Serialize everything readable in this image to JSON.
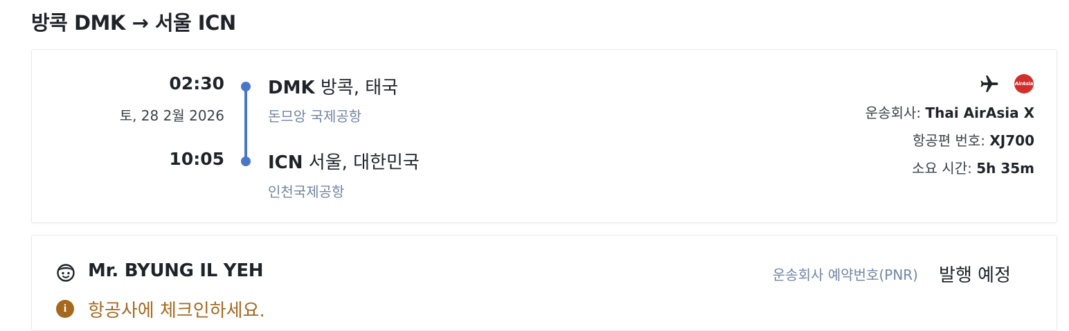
{
  "route_title": "방콕 DMK → 서울 ICN",
  "departure": {
    "time": "02:30",
    "date": "토, 28 2월 2026",
    "code": "DMK",
    "city": "방콕, 태국",
    "airport": "돈므앙 국제공항"
  },
  "arrival": {
    "time": "10:05",
    "code": "ICN",
    "city": "서울, 대한민국",
    "airport": "인천국제공항"
  },
  "flight_info": {
    "carrier_label": "운송회사: ",
    "carrier_value": "Thai AirAsia X",
    "flight_no_label": "항공편 번호: ",
    "flight_no_value": "XJ700",
    "duration_label": "소요 시간: ",
    "duration_value": "5h 35m",
    "logo_text": "AirAsia",
    "logo_color": "#d42e2b",
    "plane_icon": "airplane-icon"
  },
  "passenger": {
    "name": "Mr. BYUNG IL YEH",
    "pnr_label": "운송회사 예약번호(PNR)",
    "pnr_value": "발행 예정",
    "notice": "항공사에 체크인하세요.",
    "face_icon": "face-icon",
    "info_icon": "info-icon",
    "notice_color": "#a5681d"
  },
  "colors": {
    "timeline": "#4a76c9",
    "muted_text": "#7185a3"
  }
}
